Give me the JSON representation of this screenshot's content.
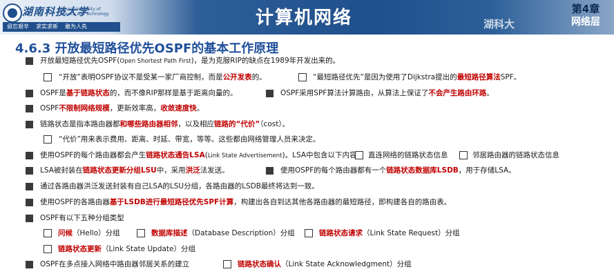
{
  "header": {
    "school_name": "湖南科技大学",
    "school_en": "Hunan University of Science and Technology",
    "motto": [
      "毋忘艰辛",
      "求实求新",
      "敢为人先"
    ],
    "course_title": "计算机网络",
    "chapter": "第4章",
    "chapter_sub": "网络层",
    "watermark": "湖科大"
  },
  "section_title": "4.6.3 开放最短路径优先OSPF的基本工作原理",
  "lines": {
    "l1": {
      "a": "开放最短路径优先OSPF(",
      "b": "Open Shortest Path First",
      "c": ")，是为克服RIP的缺点在1989年开发出来的。"
    },
    "l2a": {
      "a": "“开放”表明OSPF协议不是受某一家厂商控制，而是",
      "r": "公开发表",
      "c": "的。"
    },
    "l2b": {
      "a": "“最短路径优先”是因为使用了Dijkstra提出的",
      "r": "最短路径算法",
      "c": "SPF。"
    },
    "l3a": {
      "a": "OSPF是",
      "r": "基于链路状态",
      "c": "的，而不像RIP那样是基于距离向量的。"
    },
    "l3b": {
      "a": "OSPF采用SPF算法计算路由，从算法上保证了",
      "r": "不会产生路由环路",
      "c": "。"
    },
    "l4": {
      "a": "OSPF",
      "r": "不限制网络规模",
      "b": "，更新效率高，",
      "r2": "收敛速度快",
      "c": "。"
    },
    "l5": {
      "a": "链路状态是指本路由器都",
      "r": "和哪些路由器相邻",
      "b": "，以及相应",
      "r2": "链路的“代价”",
      "c": "（cost）。"
    },
    "l6": {
      "a": "“代价”用来表示费用、距离、时延、带宽，等等。这些都由网络管理人员来决定。"
    },
    "l7": {
      "a": "使用OSPF的每个路由器都会产生",
      "r": "链路状态通告LSA",
      "b": "(",
      "s": "Link State Advertisement",
      "c": ")。LSA中包含以下内容：",
      "o1": "直连网络的链路状态信息",
      "o2": "邻居路由器的链路状态信息"
    },
    "l8a": {
      "a": "LSA被封装在",
      "r": "链路状态更新分组LSU",
      "b": "中，采用",
      "r2": "洪泛",
      "c": "法发送。"
    },
    "l8b": {
      "a": "使用OSPF的每个路由器都有一个",
      "r": "链路状态数据库LSDB",
      "c": "，用于存储LSA。"
    },
    "l9": {
      "a": "通过各路由器洪泛发送封装有自己LSA的LSU分组，各路由器的LSDB最终将达到一致。"
    },
    "l10": {
      "a": "使用OSPF的各路由器",
      "r": "基于LSDB进行最短路径优先SPF计算",
      "c": "，构建出各自到达其他各路由器的最短路径，即构建各自的路由表。"
    },
    "l11": {
      "a": "OSPF有以下五种分组类型"
    },
    "p1": {
      "r": "问候",
      "c": "（Hello）分组"
    },
    "p2": {
      "r": "数据库描述",
      "c": "（Database Description）分组"
    },
    "p3": {
      "r": "链路状态请求",
      "c": "（Link State Request）分组"
    },
    "p4": {
      "r": "链路状态更新",
      "c": "（Link State Update）分组"
    },
    "l12": {
      "a": "OSPF在多点接入网络中路由器邻居关系的建立"
    },
    "p5": {
      "r": "链路状态确认",
      "c": "（Link State Acknowledgment）分组"
    }
  }
}
